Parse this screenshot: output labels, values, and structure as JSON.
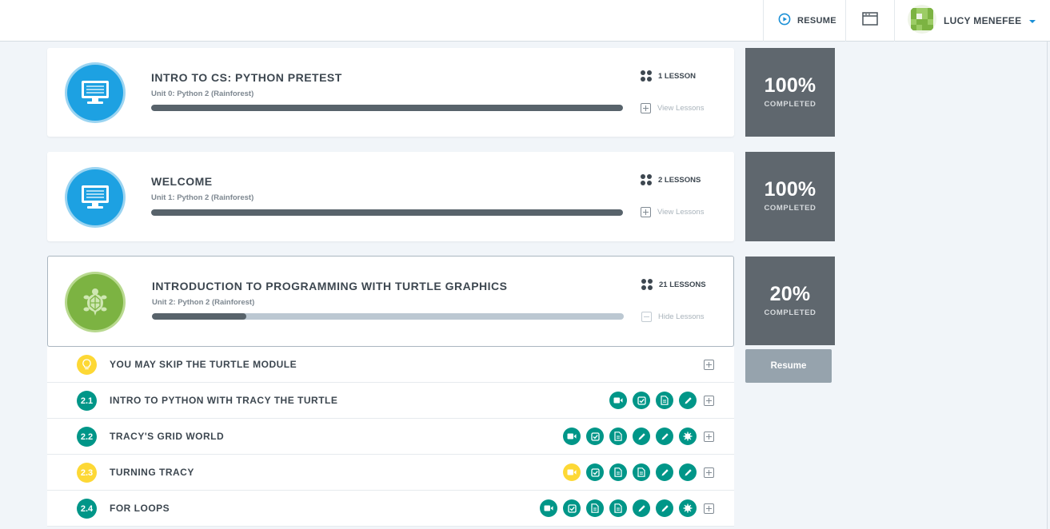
{
  "header": {
    "resume_label": "RESUME",
    "user_name": "LUCY MENEFEE"
  },
  "modules": [
    {
      "title": "INTRO TO CS: PYTHON PRETEST",
      "unit": "Unit 0: Python 2 (Rainforest)",
      "lesson_count": "1 LESSON",
      "toggle_label": "View Lessons",
      "progress": 1.0,
      "percent": "100%",
      "completed_label": "COMPLETED",
      "icon": "computer-icon"
    },
    {
      "title": "WELCOME",
      "unit": "Unit 1: Python 2 (Rainforest)",
      "lesson_count": "2 LESSONS",
      "toggle_label": "View Lessons",
      "progress": 1.0,
      "percent": "100%",
      "completed_label": "COMPLETED",
      "icon": "computer-icon"
    },
    {
      "title": "INTRODUCTION TO PROGRAMMING WITH TURTLE GRAPHICS",
      "unit": "Unit 2: Python 2 (Rainforest)",
      "lesson_count": "21 LESSONS",
      "toggle_label": "Hide Lessons",
      "progress": 0.2,
      "percent": "20%",
      "completed_label": "COMPLETED",
      "icon": "turtle-icon"
    }
  ],
  "resume_button": "Resume",
  "lessons": [
    {
      "number": "",
      "title": "YOU MAY SKIP THE TURTLE MODULE",
      "badge": "lightbulb-icon",
      "badge_color": "#fdd835",
      "activities": []
    },
    {
      "number": "2.1",
      "title": "INTRO TO PYTHON WITH TRACY THE TURTLE",
      "badge_color": "#009688",
      "activities": [
        "video",
        "quiz",
        "document",
        "exercise"
      ]
    },
    {
      "number": "2.2",
      "title": "TRACY'S GRID WORLD",
      "badge_color": "#009688",
      "activities": [
        "video",
        "quiz",
        "document",
        "exercise",
        "exercise",
        "challenge"
      ]
    },
    {
      "number": "2.3",
      "title": "TURNING TRACY",
      "badge_color": "#fdd835",
      "activities": [
        "video-yellow",
        "quiz",
        "document",
        "document",
        "exercise",
        "exercise"
      ]
    },
    {
      "number": "2.4",
      "title": "FOR LOOPS",
      "badge_color": "#009688",
      "activities": [
        "video",
        "quiz",
        "document",
        "document",
        "exercise",
        "exercise",
        "challenge"
      ]
    }
  ],
  "colors": {
    "teal": "#009688",
    "yellow": "#fdd835",
    "blue": "#1da1e2",
    "green": "#7cb342",
    "tile": "#5f676e"
  }
}
